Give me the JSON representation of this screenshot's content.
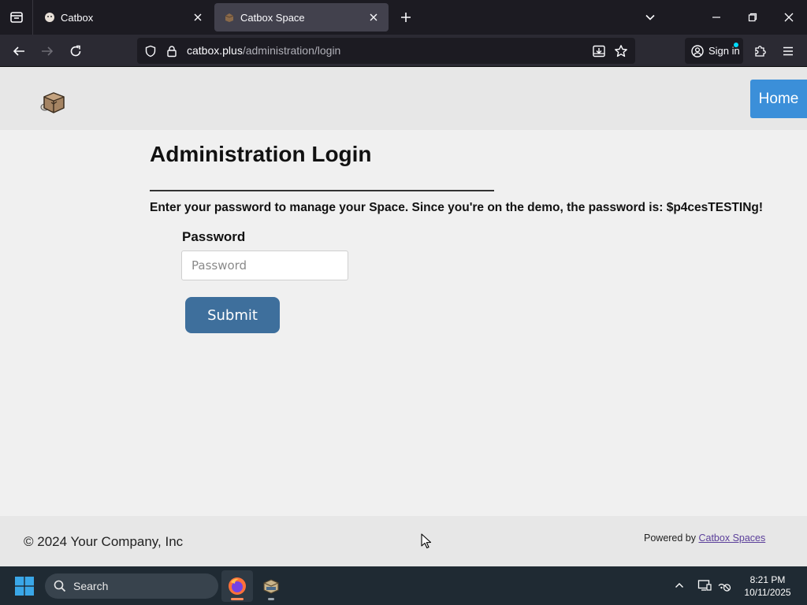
{
  "browser": {
    "tabs": [
      {
        "title": "Catbox",
        "active": false
      },
      {
        "title": "Catbox Space",
        "active": true
      }
    ],
    "url": {
      "domain": "catbox.plus",
      "path": "/administration/login"
    },
    "signin_label": "Sign in",
    "accent_color": "#00ddff"
  },
  "site": {
    "nav": {
      "home_label": "Home"
    },
    "colors": {
      "home_button": "#3b8fd9",
      "submit_button": "#3e6f9c",
      "footer_link": "#5b3f9a"
    }
  },
  "login": {
    "title": "Administration Login",
    "instructions": "Enter your password to manage your Space. Since you're on the demo, the password is: $p4cesTESTINg!",
    "password_label": "Password",
    "password_placeholder": "Password",
    "password_value": "",
    "submit_label": "Submit"
  },
  "footer": {
    "copyright": "© 2024 Your Company, Inc",
    "powered_prefix": "Powered by ",
    "powered_link": "Catbox Spaces"
  },
  "taskbar": {
    "search_label": "Search",
    "apps": [
      "firefox-icon",
      "catbox-app-icon"
    ],
    "time": "8:21 PM",
    "date": "10/11/2025"
  }
}
